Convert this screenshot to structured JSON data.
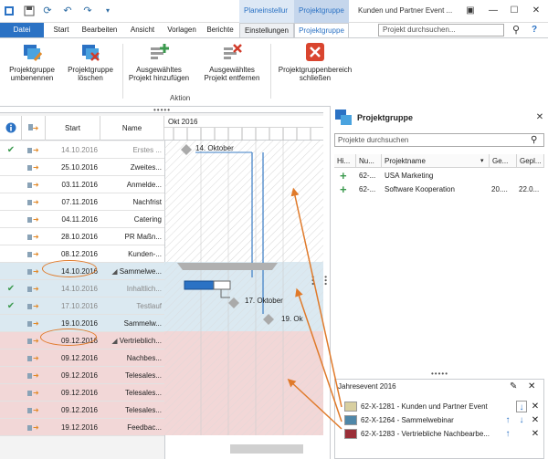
{
  "titlebar": {
    "context_group_1": "Planeinstellur",
    "context_group_2": "Projektgruppe",
    "window_title": "Kunden und Partner Event ...",
    "tabs": [
      "Datei",
      "Start",
      "Bearbeiten",
      "Ansicht",
      "Vorlagen",
      "Berichte",
      "Einstellungen",
      "Projektgruppe"
    ],
    "search_placeholder": "Projekt durchsuchen..."
  },
  "ribbon": {
    "buttons": [
      {
        "line1": "Projektgruppe",
        "line2": "umbenennen",
        "icon": "rename-icon"
      },
      {
        "line1": "Projektgruppe",
        "line2": "löschen",
        "icon": "delete-group-icon"
      },
      {
        "line1": "Ausgewähltes",
        "line2": "Projekt hinzufügen",
        "icon": "add-project-icon"
      },
      {
        "line1": "Ausgewähltes",
        "line2": "Projekt entfernen",
        "icon": "remove-project-icon"
      },
      {
        "line1": "Projektgruppenbereich",
        "line2": "schließen",
        "icon": "close-panel-icon"
      }
    ],
    "group_label": "Aktion"
  },
  "grid": {
    "col_start": "Start",
    "col_name": "Name",
    "rows": [
      {
        "check": true,
        "start": "14.10.2016",
        "name": "Erstes ...",
        "band": "none",
        "faded": true
      },
      {
        "check": false,
        "start": "25.10.2016",
        "name": "Zweites...",
        "band": "none",
        "faded": false
      },
      {
        "check": false,
        "start": "03.11.2016",
        "name": "Anmelde...",
        "band": "none",
        "faded": false
      },
      {
        "check": false,
        "start": "07.11.2016",
        "name": "Nachfrist",
        "band": "none",
        "faded": false
      },
      {
        "check": false,
        "start": "04.11.2016",
        "name": "Catering",
        "band": "none",
        "faded": false
      },
      {
        "check": false,
        "start": "28.10.2016",
        "name": "PR Maßn...",
        "band": "none",
        "faded": false
      },
      {
        "check": false,
        "start": "08.12.2016",
        "name": "Kunden-...",
        "band": "none",
        "faded": false
      },
      {
        "check": false,
        "start": "14.10.2016",
        "name": "Sammelwe...",
        "band": "blue",
        "faded": false,
        "summary": true
      },
      {
        "check": true,
        "start": "14.10.2016",
        "name": "Inhaltlich...",
        "band": "blue",
        "faded": true
      },
      {
        "check": true,
        "start": "17.10.2016",
        "name": "Testlauf",
        "band": "blue",
        "faded": true
      },
      {
        "check": false,
        "start": "19.10.2016",
        "name": "Sammelw...",
        "band": "blue",
        "faded": false
      },
      {
        "check": false,
        "start": "09.12.2016",
        "name": "Vertrieblich...",
        "band": "red",
        "faded": false,
        "summary": true
      },
      {
        "check": false,
        "start": "09.12.2016",
        "name": "Nachbes...",
        "band": "red",
        "faded": false
      },
      {
        "check": false,
        "start": "09.12.2016",
        "name": "Telesales...",
        "band": "red",
        "faded": false
      },
      {
        "check": false,
        "start": "09.12.2016",
        "name": "Telesales...",
        "band": "red",
        "faded": false
      },
      {
        "check": false,
        "start": "09.12.2016",
        "name": "Telesales...",
        "band": "red",
        "faded": false
      },
      {
        "check": false,
        "start": "19.12.2016",
        "name": "Feedbac...",
        "band": "red",
        "faded": false
      }
    ]
  },
  "chart": {
    "month_label": "Okt 2016",
    "labels": {
      "m1": "14. Oktober",
      "m2": "17. Oktober",
      "m3": "19. Ok"
    }
  },
  "panel": {
    "title": "Projektgruppe",
    "search_placeholder": "Projekte durchsuchen",
    "columns": [
      "Hi...",
      "Nu...",
      "Projektname",
      "Ge...",
      "Gepl..."
    ],
    "rows": [
      {
        "nr": "62-...",
        "name": "USA Marketing",
        "ge": "",
        "gepl": ""
      },
      {
        "nr": "62-...",
        "name": "Software Kooperation",
        "ge": "20....",
        "gepl": "22.0..."
      }
    ],
    "group_title": "Jahresevent 2016",
    "events": [
      {
        "label": "62-X-1281 - Kunden und Partner Event",
        "color": "#d8cfa0"
      },
      {
        "label": "62-X-1264 - Sammelwebinar",
        "color": "#4f87a8"
      },
      {
        "label": "62-X-1283 - Vertriebliche Nachbearbe...",
        "color": "#9b2f38"
      }
    ]
  },
  "colors": {
    "accent": "#2b72c4",
    "orange": "#e07a2a",
    "band_blue": "#dbe9f1",
    "band_red": "#f2d7d7"
  }
}
